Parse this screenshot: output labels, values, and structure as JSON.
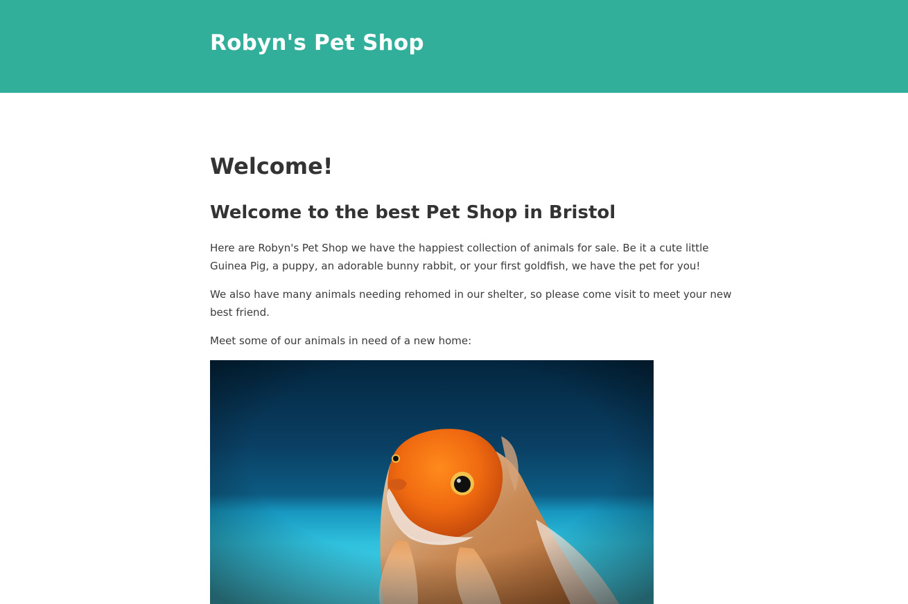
{
  "header": {
    "site_title": "Robyn's Pet Shop",
    "background_color": "#31af9b"
  },
  "main": {
    "heading": "Welcome!",
    "subheading": "Welcome to the best Pet Shop in Bristol",
    "paragraphs": [
      "Here are Robyn's Pet Shop we have the happiest collection of animals for sale. Be it a cute little Guinea Pig, a puppy, an adorable bunny rabbit, or your first goldfish, we have the pet for you!",
      "We also have many animals needing rehomed in our shelter, so please come visit to meet your new best friend.",
      "Meet some of our animals in need of a new home:"
    ],
    "image": {
      "subject": "goldfish-photo"
    }
  }
}
